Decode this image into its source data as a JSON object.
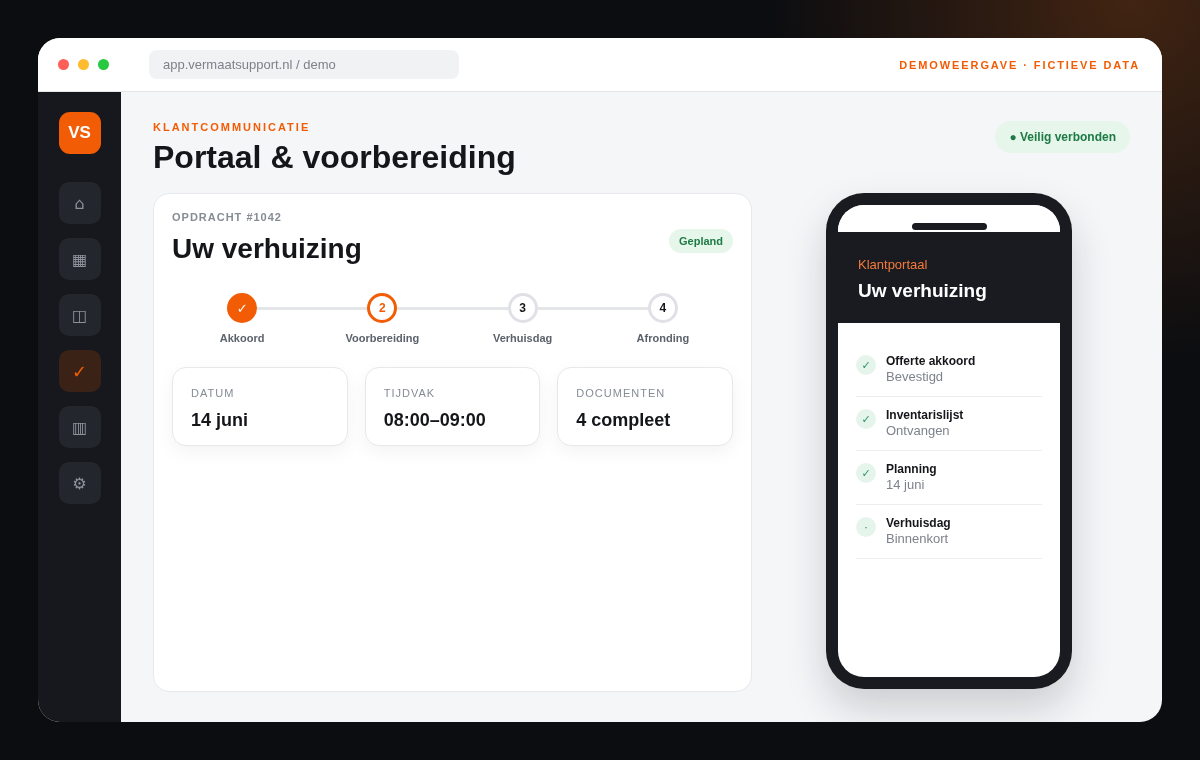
{
  "browser": {
    "url": "app.vermaatsupport.nl / demo",
    "notice": "DEMOWEERGAVE · FICTIEVE DATA"
  },
  "sidebar": {
    "logo": "VS",
    "items": [
      {
        "glyph": "⌂",
        "selected": false
      },
      {
        "glyph": "▦",
        "selected": false
      },
      {
        "glyph": "◫",
        "selected": false
      },
      {
        "glyph": "✓",
        "selected": true
      },
      {
        "glyph": "▥",
        "selected": false
      },
      {
        "glyph": "⚙",
        "selected": false
      }
    ]
  },
  "header": {
    "eyebrow": "KLANTCOMMUNICATIE",
    "title": "Portaal & voorbereiding",
    "status": "● Veilig verbonden"
  },
  "order_card": {
    "reference": "OPDRACHT #1042",
    "title": "Uw verhuizing",
    "badge": "Gepland",
    "steps": [
      {
        "kind": "done",
        "marker": "✓",
        "label": "Akkoord"
      },
      {
        "kind": "current",
        "marker": "2",
        "label": "Voorbereiding"
      },
      {
        "kind": "upcoming",
        "marker": "3",
        "label": "Verhuisdag"
      },
      {
        "kind": "upcoming",
        "marker": "4",
        "label": "Afronding"
      }
    ],
    "facts": [
      {
        "label": "DATUM",
        "value": "14 juni"
      },
      {
        "label": "TIJDVAK",
        "value": "08:00–09:00"
      },
      {
        "label": "DOCUMENTEN",
        "value": "4 compleet"
      }
    ]
  },
  "phone": {
    "eyebrow": "Klantportaal",
    "title": "Uw verhuizing",
    "items": [
      {
        "marker": "✓",
        "title": "Offerte akkoord",
        "detail": "Bevestigd"
      },
      {
        "marker": "✓",
        "title": "Inventarislijst",
        "detail": "Ontvangen"
      },
      {
        "marker": "✓",
        "title": "Planning",
        "detail": "14 juni"
      },
      {
        "marker": "·",
        "title": "Verhuisdag",
        "detail": "Binnenkort"
      }
    ]
  }
}
